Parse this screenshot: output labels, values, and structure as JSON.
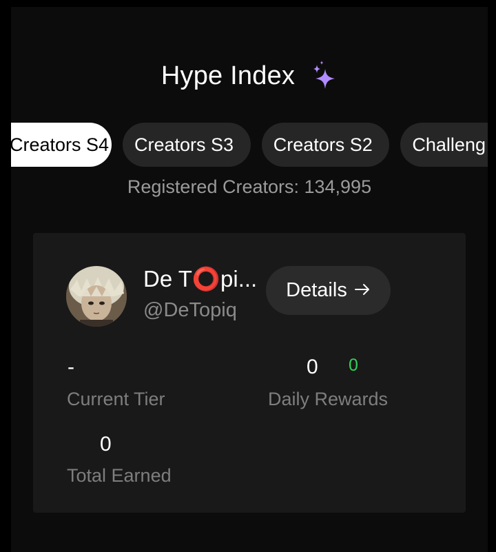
{
  "header": {
    "title": "Hype Index",
    "icon": "sparkles-icon",
    "icon_color": "#b28cff"
  },
  "tabs": [
    {
      "label": "Creators S4",
      "active": true
    },
    {
      "label": "Creators S3",
      "active": false
    },
    {
      "label": "Creators S2",
      "active": false
    },
    {
      "label": "Challeng",
      "active": false
    }
  ],
  "registered_text": "Registered Creators: 134,995",
  "card": {
    "name": "De T⭕pi...",
    "handle": "@DeTopiq",
    "details_label": "Details",
    "details_icon": "arrow-right-icon",
    "stats": {
      "current_tier": {
        "value": "-",
        "label": "Current Tier"
      },
      "daily_rewards": {
        "value": "0",
        "delta": "0",
        "label": "Daily Rewards"
      },
      "total_earned": {
        "value": "0",
        "label": "Total Earned"
      }
    }
  },
  "colors": {
    "background": "#000000",
    "panel": "#0c0c0c",
    "card": "#191919",
    "tab_inactive": "#262626",
    "tab_active": "#ffffff",
    "accent_green": "#34d058"
  }
}
